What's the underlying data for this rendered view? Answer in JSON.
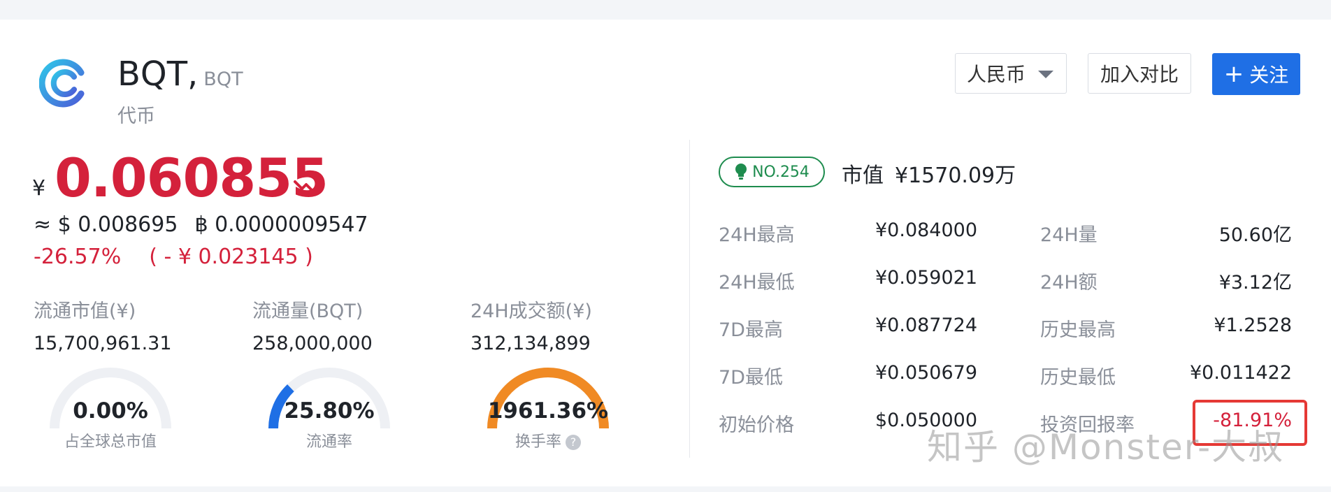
{
  "coin": {
    "name": "BQT,",
    "symbol": "BQT",
    "type": "代币"
  },
  "toolbar": {
    "currency": "人民币",
    "compare_label": "加入对比",
    "follow_label": "关注",
    "follow_plus": "+"
  },
  "price": {
    "currency_symbol": "¥",
    "value": "0.060855",
    "usd": "≈ $ 0.008695",
    "btc": "฿ 0.0000009547",
    "change_pct": "-26.57%",
    "change_amt": "( - ¥ 0.023145 )"
  },
  "stats": [
    {
      "label": "流通市值(¥)",
      "value": "15,700,961.31"
    },
    {
      "label": "流通量(BQT)",
      "value": "258,000,000"
    },
    {
      "label": "24H成交额(¥)",
      "value": "312,134,899"
    }
  ],
  "gauges": [
    {
      "pct": "0.00%",
      "label": "占全球总市值",
      "fraction": 0.0,
      "color": "#1f6fe5"
    },
    {
      "pct": "25.80%",
      "label": "流通率",
      "fraction": 0.258,
      "color": "#1f6fe5"
    },
    {
      "pct": "1961.36%",
      "label": "换手率",
      "fraction": 1.0,
      "color": "#f08a24"
    }
  ],
  "help_icon": "?",
  "rank": "NO.254",
  "market_cap": {
    "label": "市值",
    "value": "¥1570.09万"
  },
  "details": [
    {
      "l1": "24H最高",
      "v1": "¥0.084000",
      "l2": "24H量",
      "v2": "50.60亿"
    },
    {
      "l1": "24H最低",
      "v1": "¥0.059021",
      "l2": "24H额",
      "v2": "¥3.12亿"
    },
    {
      "l1": "7D最高",
      "v1": "¥0.087724",
      "l2": "历史最高",
      "v2": "¥1.2528"
    },
    {
      "l1": "7D最低",
      "v1": "¥0.050679",
      "l2": "历史最低",
      "v2": "¥0.011422"
    },
    {
      "l1": "初始价格",
      "v1": "$0.050000",
      "l2": "投资回报率",
      "v2": "-81.91%"
    }
  ],
  "watermark": "知乎 @Monster-大叔",
  "colors": {
    "up_down_red": "#d4213b",
    "accent_blue": "#1f6fe5",
    "rank_green": "#1e8c4e",
    "turnover_orange": "#f08a24"
  }
}
